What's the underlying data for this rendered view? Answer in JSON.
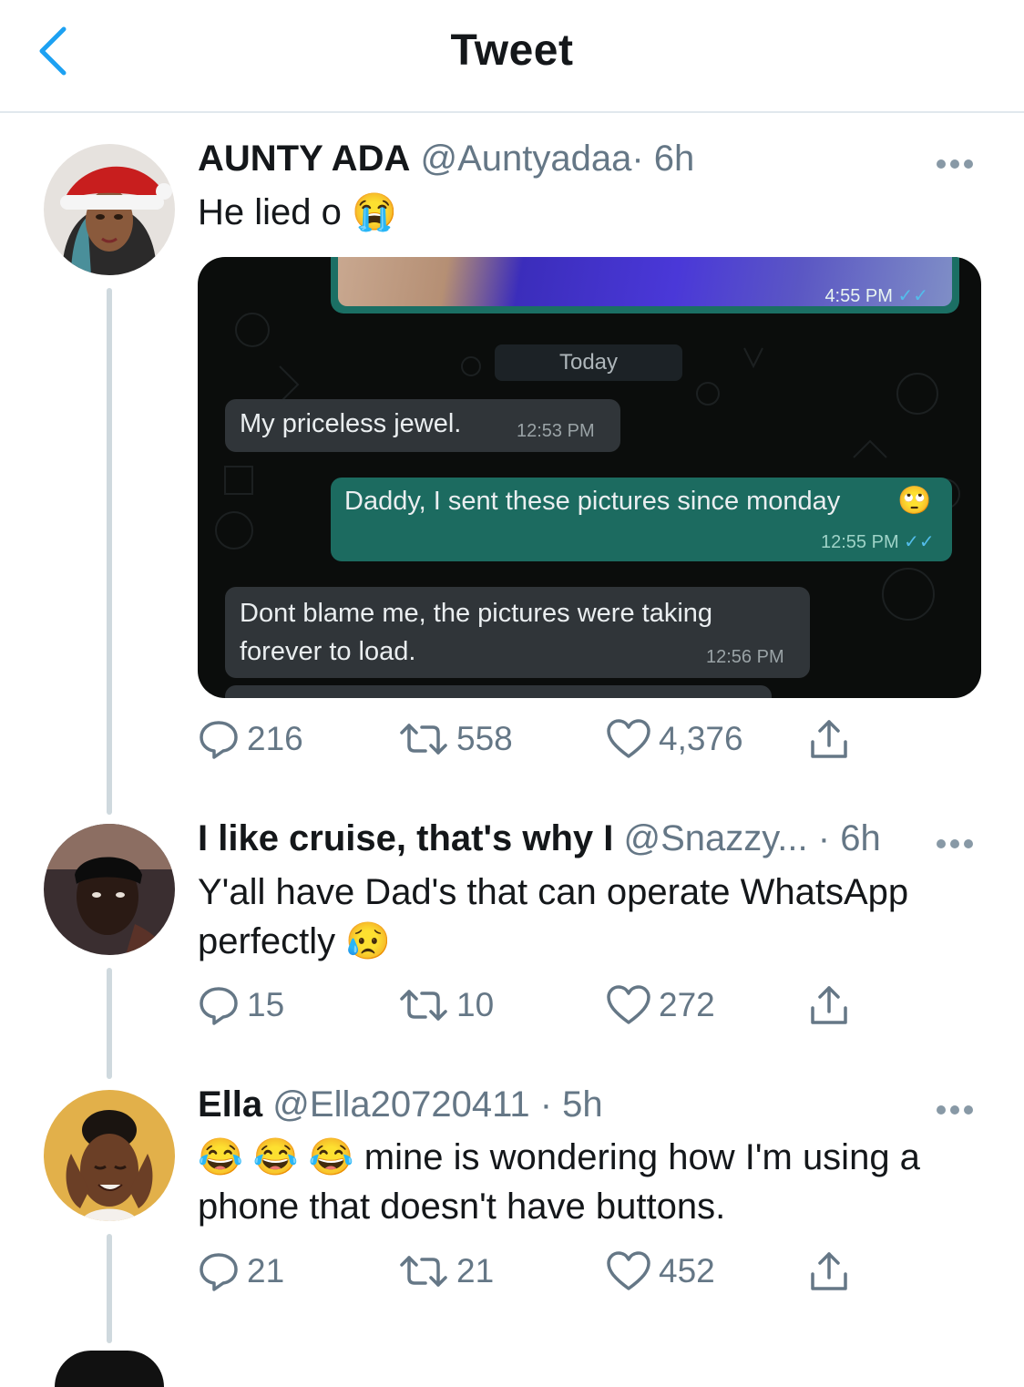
{
  "header": {
    "title": "Tweet"
  },
  "tweets": [
    {
      "name": "AUNTY ADA",
      "handle": "@Auntyadaa",
      "time": "· 6h",
      "text": "He lied o",
      "emoji": "😭",
      "media": {
        "image_time": "4:55 PM",
        "day_label": "Today",
        "messages": [
          {
            "direction": "in",
            "text": "My priceless jewel.",
            "time": "12:53 PM"
          },
          {
            "direction": "out",
            "text": "Daddy, I sent these pictures since monday",
            "emoji": "🙄",
            "time": "12:55 PM"
          },
          {
            "direction": "in",
            "text": "Dont blame me, the pictures were taking forever to load.",
            "line1": "Dont blame me, the pictures were taking",
            "line2": "forever to load.",
            "time": "12:56 PM"
          }
        ]
      },
      "replies": "216",
      "retweets": "558",
      "likes": "4,376"
    },
    {
      "name": "I like cruise, that's why I",
      "handle": "@Snazzy...",
      "time": "· 6h",
      "text_line1": "Y'all have Dad's that can operate WhatsApp",
      "text_line2": "perfectly",
      "emoji": "😥",
      "replies": "15",
      "retweets": "10",
      "likes": "272"
    },
    {
      "name": "Ella",
      "handle": "@Ella20720411",
      "time": "· 5h",
      "emoji": "😂 😂 😂",
      "text_line1": "mine is wondering how I'm using a",
      "text_line2": "phone that doesn't have buttons.",
      "replies": "21",
      "retweets": "21",
      "likes": "452"
    }
  ],
  "colors": {
    "accent": "#1da1f2",
    "muted": "#657786",
    "divider": "#e1e8ed",
    "whatsapp_out": "#1c6b60",
    "whatsapp_in": "#303539"
  }
}
